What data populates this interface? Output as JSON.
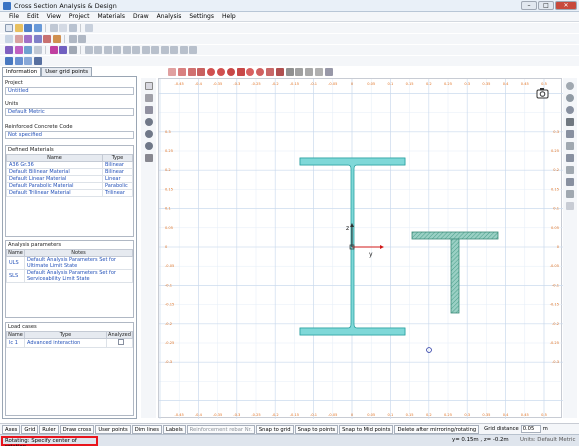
{
  "window": {
    "title": "Cross Section Analysis & Design"
  },
  "menu": [
    "File",
    "Edit",
    "View",
    "Project",
    "Materials",
    "Draw",
    "Analysis",
    "Settings",
    "Help"
  ],
  "left_tabs": [
    "Information",
    "User grid points"
  ],
  "info": {
    "project_label": "Project",
    "project_value": "Untitled",
    "units_label": "Units",
    "units_value": "Default Metric",
    "rc_code_label": "Reinforced Concrete Code",
    "rc_code_value": "Not specified"
  },
  "materials": {
    "title": "Defined Materials",
    "headers": [
      "Name",
      "Type"
    ],
    "rows": [
      {
        "name": "A36 Gr.36",
        "type": "Bilinear"
      },
      {
        "name": "Default Bilinear Material",
        "type": "Bilinear"
      },
      {
        "name": "Default Linear Material",
        "type": "Linear"
      },
      {
        "name": "Default Parabolic Material",
        "type": "Parabolic"
      },
      {
        "name": "Default Trilinear Material",
        "type": "Trilinear"
      }
    ]
  },
  "analysis_params": {
    "title": "Analysis parameters",
    "headers": [
      "Name",
      "Notes"
    ],
    "rows": [
      {
        "name": "ULS",
        "notes": "Default Analysis Parameters Set for Ultimate Limit State"
      },
      {
        "name": "SLS",
        "notes": "Default Analysis Parameters Set for Serviceability Limit State"
      }
    ]
  },
  "load_cases": {
    "title": "Load cases",
    "headers": [
      "Name",
      "Type",
      "Analyzed"
    ],
    "rows": [
      {
        "name": "lc 1",
        "type": "Advanced interaction",
        "analyzed": false
      }
    ]
  },
  "bottom_buttons": [
    {
      "label": "Axes",
      "enabled": true
    },
    {
      "label": "Grid",
      "enabled": true
    },
    {
      "label": "Ruler",
      "enabled": true
    },
    {
      "label": "Draw cross",
      "enabled": true
    },
    {
      "label": "User points",
      "enabled": true
    },
    {
      "label": "Dim lines",
      "enabled": true
    },
    {
      "label": "Labels",
      "enabled": true
    },
    {
      "label": "Reinforcement rebar Nr.",
      "enabled": false
    },
    {
      "label": "Snap to grid",
      "enabled": true
    },
    {
      "label": "Snap to points",
      "enabled": true
    },
    {
      "label": "Snap to Mid points",
      "enabled": true
    },
    {
      "label": "Delete after mirroring/rotating",
      "enabled": true
    }
  ],
  "grid_distance": {
    "label": "Grid distance",
    "value": "0.05",
    "unit": "m"
  },
  "status": {
    "message": "Rotating: Specify center of rotation",
    "coords": "y= 0.15m , z= -0.2m",
    "units": "Units: Default Metric"
  },
  "canvas": {
    "axis_y_label": "y",
    "axis_z_label": "z",
    "x_ticks": [
      "-0.5",
      "-0.45",
      "-0.4",
      "-0.35",
      "-0.3",
      "-0.25",
      "-0.2",
      "-0.15",
      "-0.1",
      "-0.05",
      "0",
      "0.05",
      "0.1",
      "0.15",
      "0.2",
      "0.25",
      "0.3",
      "0.35",
      "0.4",
      "0.45",
      "0.5"
    ],
    "y_ticks": [
      "0.3",
      "0.25",
      "0.2",
      "0.15",
      "0.1",
      "0.05",
      "0",
      "-0.05",
      "-0.1",
      "-0.15",
      "-0.2",
      "-0.25",
      "-0.3"
    ],
    "section_fill": "#7fd8d8",
    "section_stroke": "#2aa0a0",
    "hatched_fill": "#9ad0c4"
  },
  "colors": {
    "accent": "#2250b8",
    "status_highlight": "#e8141c",
    "grid": "#c8d8ec",
    "axis": "#d01818"
  }
}
